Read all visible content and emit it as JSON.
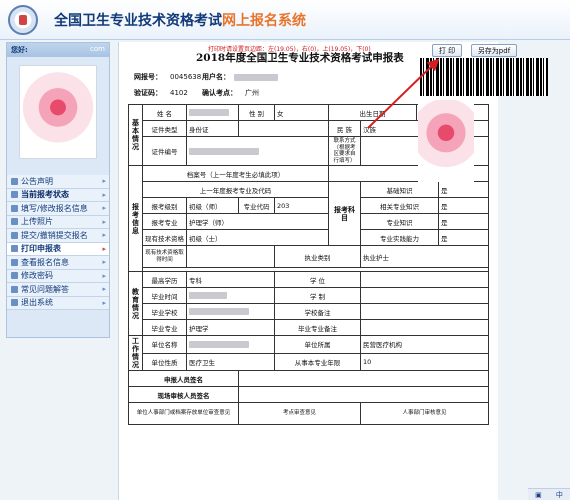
{
  "header": {
    "title_main": "全国卫生专业技术资格考试",
    "title_accent": "网上报名系统"
  },
  "sidebar": {
    "greeting": "您好:",
    "email_suffix": "com",
    "menu": [
      {
        "label": "公告声明"
      },
      {
        "label": "当前报考状态"
      },
      {
        "label": "填写/修改报名信息"
      },
      {
        "label": "上传照片"
      },
      {
        "label": "提交/撤销提交报名"
      },
      {
        "label": "打印申报表"
      },
      {
        "label": "查看报名信息"
      },
      {
        "label": "修改密码"
      },
      {
        "label": "常见问题解答"
      },
      {
        "label": "退出系统"
      }
    ]
  },
  "toolbar": {
    "print_note": "打印时请设置页边距：左(19.05)，右(0)，上(19.05)，下(0)",
    "print_label": "打 印",
    "save_pdf_label": "另存为pdf"
  },
  "form": {
    "title": "2018年度全国卫生专业技术资格考试申报表",
    "reg_no_label": "网报号：",
    "reg_no": "0045638",
    "username_label": "用户名：",
    "verify_code_label": "验证码：",
    "verify_code": "4102",
    "exam_site_label": "确认考点：",
    "exam_site": "广州",
    "sections": {
      "basic": "基本情况",
      "exam": "报考信息",
      "exam_subjects": "报考科目",
      "edu": "教育情况",
      "work": "工作情况"
    },
    "labels": {
      "name": "姓    名",
      "gender": "性    别",
      "gender_val": "女",
      "birth": "出生日期",
      "id_type": "证件类型",
      "id_type_val": "身份证",
      "ethnic": "民    族",
      "ethnic_val": "汉族",
      "id_no": "证件编号",
      "contact": "联系方式（根据考区要求自行填写）",
      "archive": "档案号（上一年度考生必填此项）",
      "last_subject": "上一年度报考专业及代码",
      "basic_knowledge": "基础知识",
      "yes": "是",
      "level": "报考级别",
      "level_val": "初级（师）",
      "major_code": "专业代码",
      "major_code_val": "203",
      "related_knowledge": "相关专业知识",
      "major": "报考专业",
      "major_val": "护理学（师）",
      "professional_knowledge": "专业知识",
      "title_held": "现有技术资格",
      "title_held_val": "初级（士）",
      "practice_ability": "专业实践能力",
      "title_time": "现有技术资格取得时间",
      "practice_type": "执业类别",
      "practice_type_val": "执业护士",
      "edu_top": "最高学历",
      "edu_top_val": "专科",
      "degree": "学    位",
      "grad_time": "毕业时间",
      "schooling": "学    制",
      "school": "毕业学校",
      "school_note": "学校备注",
      "grad_major": "毕业专业",
      "grad_major_val": "护理学",
      "grad_major_note": "毕业专业备注",
      "unit_name": "单位名称",
      "unit_owner": "单位所属",
      "unit_owner_val": "民营医疗机构",
      "unit_type": "单位性质",
      "unit_type_val": "医疗卫生",
      "work_years": "从事本专业年限",
      "work_years_val": "10",
      "applicant_sign": "申报人员签名",
      "reviewer_sign": "现场审核人员签名",
      "unit_opinion": "单位人事部门或档案存放单位审查意见",
      "site_opinion": "考点审查意见",
      "hr_opinion": "人事部门审核意见"
    }
  },
  "tray": {
    "input_lang": "中"
  }
}
